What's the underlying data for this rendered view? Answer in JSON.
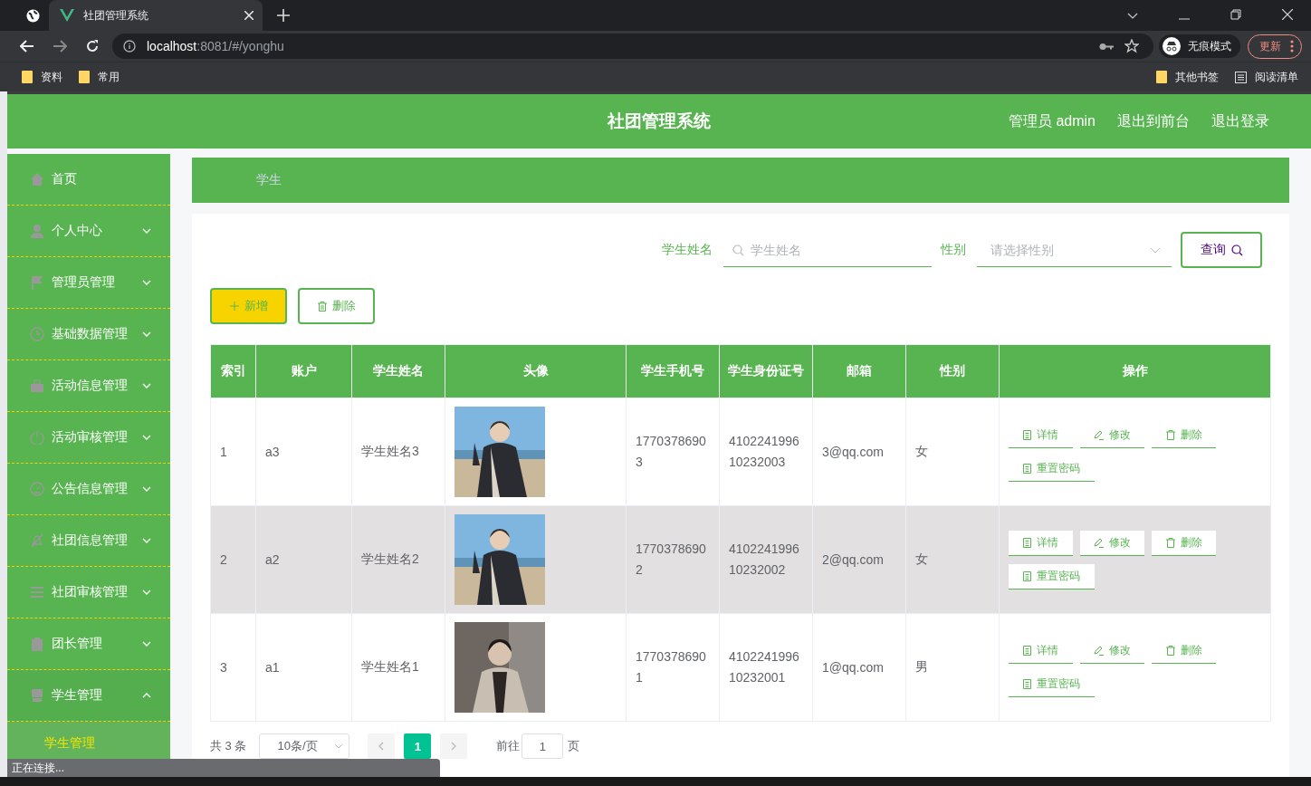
{
  "browser": {
    "tabs": [
      {
        "kind": "icon",
        "selected": false
      },
      {
        "kind": "page",
        "title": "社团管理系统",
        "selected": true
      }
    ],
    "url": {
      "host": "localhost",
      "path": ":8081/#/yonghu"
    },
    "profile": "无痕模式",
    "update": "更新",
    "bookmarks": [
      "资料",
      "常用"
    ],
    "bookmarks_right": [
      "其他书签",
      "阅读清单"
    ]
  },
  "header": {
    "title": "社团管理系统",
    "links": [
      "管理员 admin",
      "退出到前台",
      "退出登录"
    ]
  },
  "sidebar": {
    "items": [
      {
        "label": "首页",
        "kind": "link"
      },
      {
        "label": "个人中心",
        "kind": "menu",
        "expanded": false
      },
      {
        "label": "管理员管理",
        "kind": "menu",
        "expanded": false
      },
      {
        "label": "基础数据管理",
        "kind": "menu",
        "expanded": false
      },
      {
        "label": "活动信息管理",
        "kind": "menu",
        "expanded": false
      },
      {
        "label": "活动审核管理",
        "kind": "menu",
        "expanded": false
      },
      {
        "label": "公告信息管理",
        "kind": "menu",
        "expanded": false
      },
      {
        "label": "社团信息管理",
        "kind": "menu",
        "expanded": false
      },
      {
        "label": "社团审核管理",
        "kind": "menu",
        "expanded": false
      },
      {
        "label": "团长管理",
        "kind": "menu",
        "expanded": false
      },
      {
        "label": "学生管理",
        "kind": "menu",
        "expanded": true,
        "children": [
          {
            "label": "学生管理",
            "selected": true
          }
        ]
      }
    ]
  },
  "breadcrumb": "学生",
  "search": {
    "name_label": "学生姓名",
    "name_placeholder": "学生姓名",
    "gender_label": "性别",
    "gender_placeholder": "请选择性别",
    "button": "查询"
  },
  "actions": {
    "add": "新增",
    "delete": "删除"
  },
  "table": {
    "columns": [
      "索引",
      "账户",
      "学生姓名",
      "头像",
      "学生手机号",
      "学生身份证号",
      "邮箱",
      "性别",
      "操作"
    ],
    "rows": [
      {
        "cells": [
          "1",
          "a3",
          "学生姓名3",
          "",
          "17703786903",
          "410224199610232003",
          "3@qq.com",
          "女"
        ],
        "highlighted": false,
        "ops": [
          "详情",
          "修改",
          "删除",
          "重置密码"
        ]
      },
      {
        "cells": [
          "2",
          "a2",
          "学生姓名2",
          "",
          "17703786902",
          "410224199610232002",
          "2@qq.com",
          "女"
        ],
        "highlighted": true,
        "ops": [
          "详情",
          "修改",
          "删除",
          "重置密码"
        ]
      },
      {
        "cells": [
          "3",
          "a1",
          "学生姓名1",
          "",
          "17703786901",
          "410224199610232001",
          "1@qq.com",
          "男"
        ],
        "highlighted": false,
        "ops": [
          "详情",
          "修改",
          "删除",
          "重置密码"
        ]
      }
    ]
  },
  "pagination": {
    "total": "共 3 条",
    "page_size": "10条/页",
    "pages": [
      {
        "label": "1",
        "selected": true
      }
    ],
    "goto": "前往",
    "goto_value": "1",
    "page_unit": "页"
  },
  "status": "正在连接..."
}
